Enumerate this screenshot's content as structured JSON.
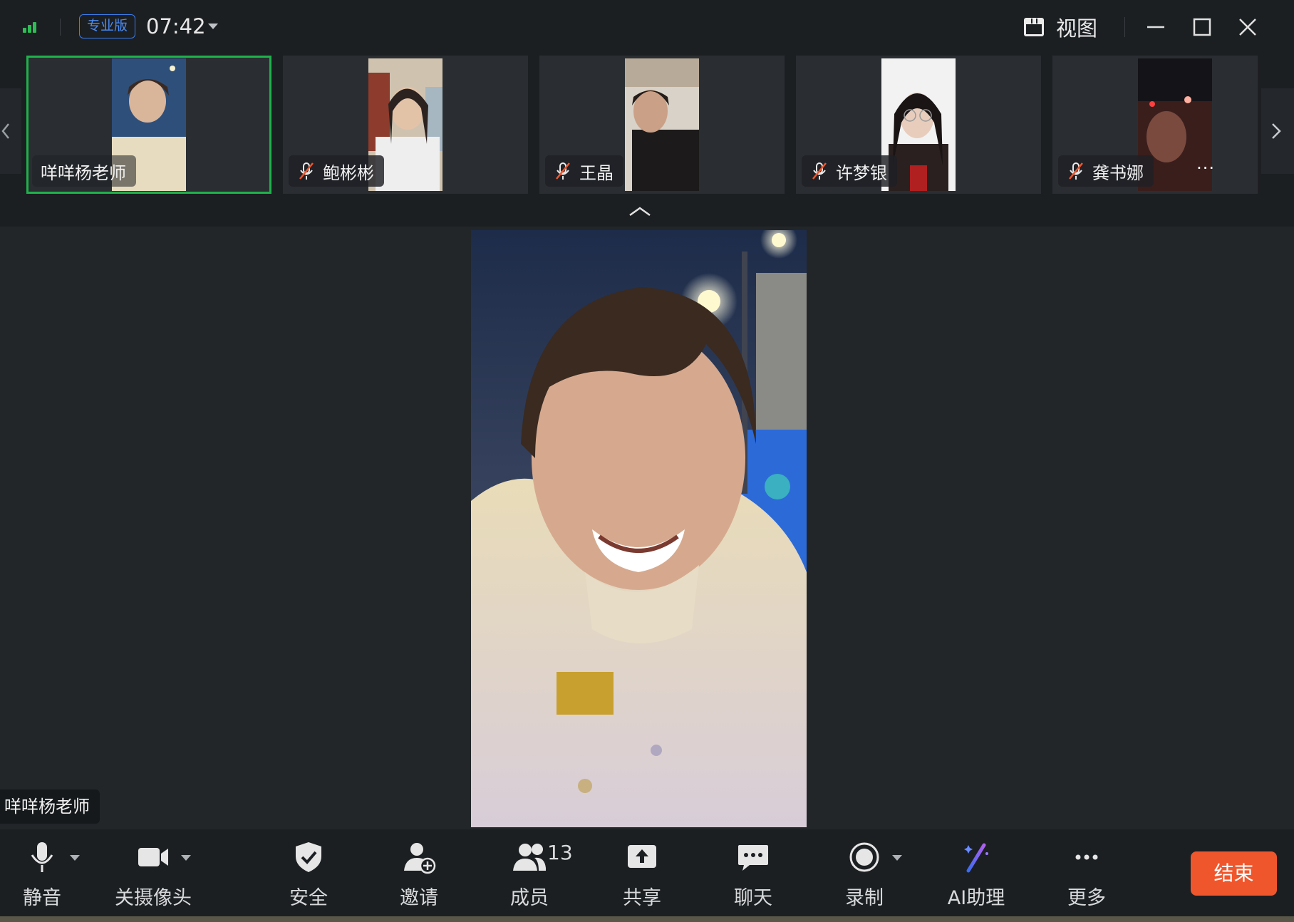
{
  "titlebar": {
    "plan_badge": "专业版",
    "timer": "07:42",
    "view_label": "视图"
  },
  "participants": [
    {
      "name": "咩咩杨老师",
      "muted": false,
      "active": true
    },
    {
      "name": "鲍彬彬",
      "muted": true,
      "active": false
    },
    {
      "name": "王晶",
      "muted": true,
      "active": false
    },
    {
      "name": "许梦银",
      "muted": true,
      "active": false
    },
    {
      "name": "龚书娜",
      "muted": true,
      "active": false
    }
  ],
  "tile_more_label": "···",
  "main_speaker": "咩咩杨老师",
  "toolbar": {
    "mute": "静音",
    "camera": "关摄像头",
    "security": "安全",
    "invite": "邀请",
    "members": "成员",
    "members_count": "13",
    "share": "共享",
    "chat": "聊天",
    "record": "录制",
    "ai": "AI助理",
    "more": "更多",
    "end": "结束"
  },
  "colors": {
    "active_border": "#1fb14a",
    "end_button": "#f0562b",
    "plan_badge": "#3a7ef0",
    "signal": "#2ebd55"
  }
}
